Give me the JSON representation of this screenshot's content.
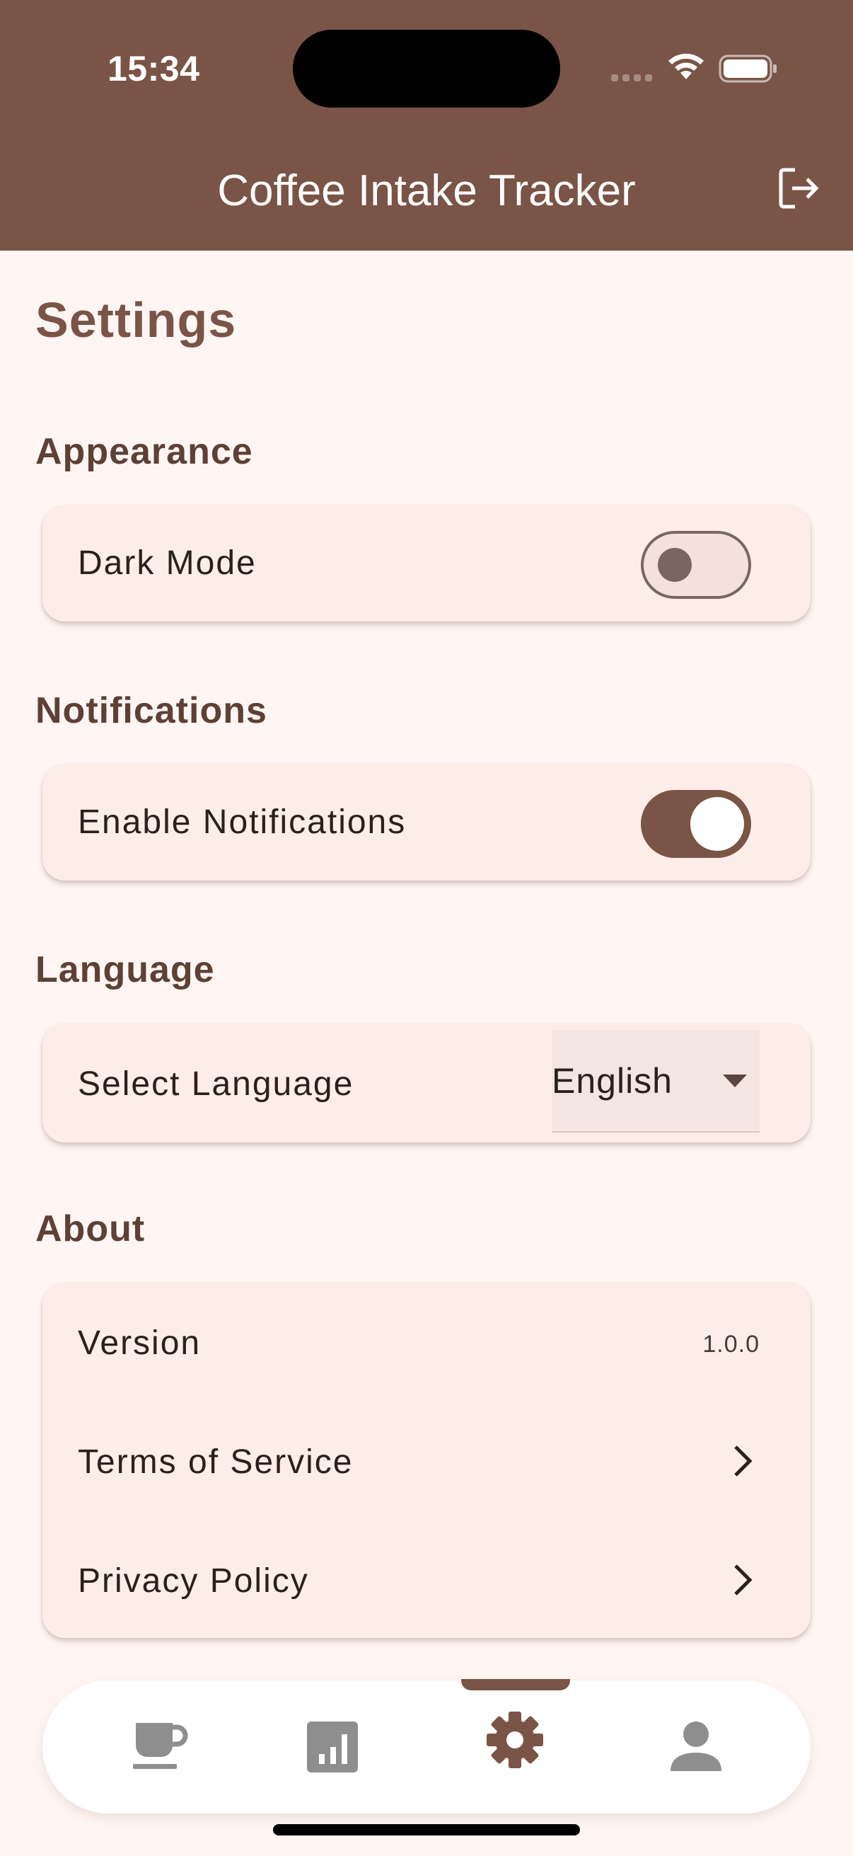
{
  "status_bar": {
    "time": "15:34",
    "icons": [
      "signal-icon",
      "wifi-icon",
      "battery-icon"
    ]
  },
  "app_bar": {
    "title": "Coffee Intake Tracker",
    "action_icon": "logout-icon"
  },
  "page": {
    "title": "Settings"
  },
  "sections": {
    "appearance": {
      "title": "Appearance",
      "dark_mode_label": "Dark Mode",
      "dark_mode_on": false
    },
    "notifications": {
      "title": "Notifications",
      "enable_label": "Enable Notifications",
      "enable_on": true
    },
    "language": {
      "title": "Language",
      "select_label": "Select Language",
      "selected": "English"
    },
    "about": {
      "title": "About",
      "version_label": "Version",
      "version_value": "1.0.0",
      "terms_label": "Terms of Service",
      "privacy_label": "Privacy Policy"
    }
  },
  "bottom_nav": {
    "items": [
      {
        "icon": "coffee-cup-icon",
        "active": false
      },
      {
        "icon": "stats-icon",
        "active": false
      },
      {
        "icon": "settings-gear-icon",
        "active": true
      },
      {
        "icon": "profile-icon",
        "active": false
      }
    ]
  },
  "colors": {
    "primary": "#7A5446",
    "background": "#FFF6F3",
    "card": "#FCEDE8",
    "section_title": "#5E4035",
    "nav_inactive": "#8E8E8E"
  }
}
